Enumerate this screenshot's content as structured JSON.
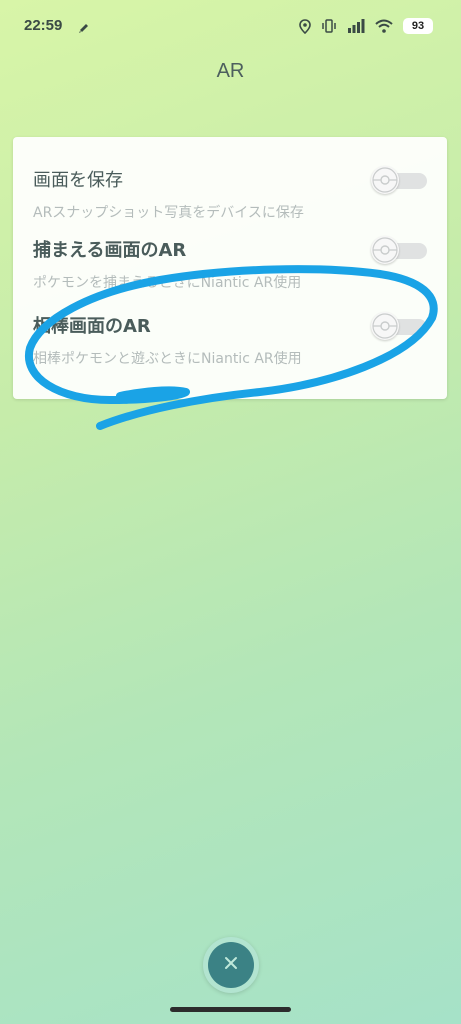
{
  "status_bar": {
    "time": "22:59",
    "battery": "93",
    "icons": [
      "notification-icon",
      "location-icon",
      "vibrate-icon",
      "signal-icon",
      "wifi-icon"
    ]
  },
  "page": {
    "title": "AR"
  },
  "settings": [
    {
      "title": "画面を保存",
      "description": "ARスナップショット写真をデバイスに保存",
      "enabled": false
    },
    {
      "title": "捕まえる画面のAR",
      "description": "ポケモンを捕まえるときにNiantic AR使用",
      "enabled": false
    },
    {
      "title": "相棒画面のAR",
      "description": "相棒ポケモンと遊ぶときにNiantic AR使用",
      "enabled": false
    }
  ],
  "close_button": {
    "icon": "close-icon"
  },
  "colors": {
    "annotation": "#1aa3e6",
    "close_button": "#3b8285",
    "title_text": "#4d5f5e",
    "description_text": "#b4bcbb"
  }
}
